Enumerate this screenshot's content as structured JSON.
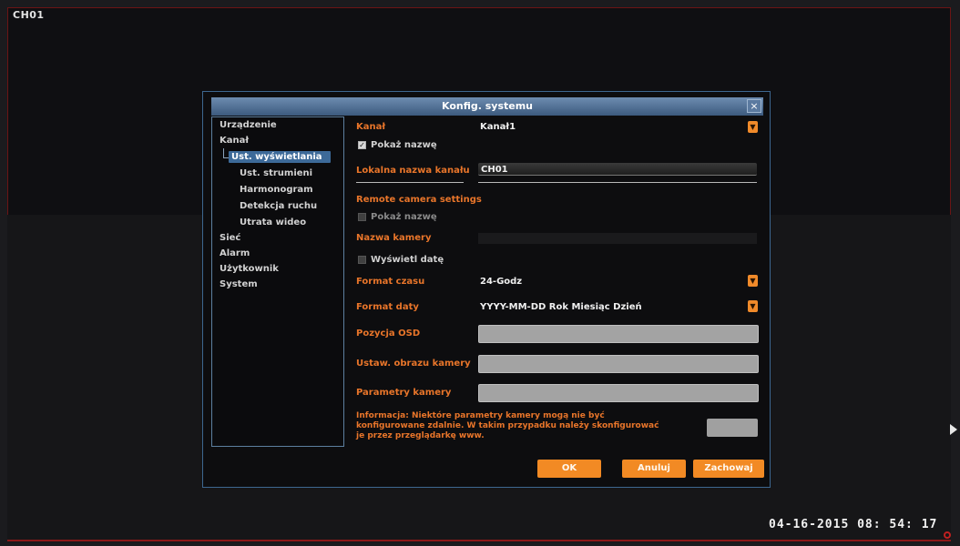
{
  "screen": {
    "channel": "CH01",
    "datetime": "04-16-2015 08: 54: 17"
  },
  "dialog": {
    "title": "Konfig. systemu",
    "close": "×"
  },
  "nav": {
    "items": [
      {
        "label": "Urządzenie"
      },
      {
        "label": "Kanał"
      },
      {
        "label": "Ust. wyświetlania"
      },
      {
        "label": "Ust. strumieni"
      },
      {
        "label": "Harmonogram"
      },
      {
        "label": "Detekcja ruchu"
      },
      {
        "label": "Utrata wideo"
      },
      {
        "label": "Sieć"
      },
      {
        "label": "Alarm"
      },
      {
        "label": "Użytkownik"
      },
      {
        "label": "System"
      }
    ]
  },
  "form": {
    "kanal_label": "Kanał",
    "kanal_value": "Kanał1",
    "show_name_label": "Pokaż nazwę",
    "show_name_checked": true,
    "local_name_label": "Lokalna nazwa kanału",
    "local_name_value": "CH01",
    "remote_heading": "Remote camera settings",
    "remote_show_name_label": "Pokaż nazwę",
    "camera_name_label": "Nazwa kamery",
    "show_date_label": "Wyświetl datę",
    "time_format_label": "Format czasu",
    "time_format_value": "24-Godz",
    "date_format_label": "Format daty",
    "date_format_value": "YYYY-MM-DD Rok Miesiąc Dzień",
    "osd_position_label": "Pozycja OSD",
    "image_settings_label": "Ustaw. obrazu kamery",
    "camera_params_label": "Parametry kamery",
    "info_text_1": "Informacja: Niektóre parametry kamery mogą nie być",
    "info_text_2": "konfigurowane zdalnie. W takim przypadku należy skonfigurować",
    "info_text_3": "je przez przeglądarkę www."
  },
  "buttons": {
    "ok": "OK",
    "cancel": "Anuluj",
    "save": "Zachowaj"
  },
  "icons": {
    "dropdown": "chevron-down-icon",
    "close": "close-icon",
    "check": "✓"
  },
  "colors": {
    "accent": "#f28a24",
    "label": "#e8752a",
    "selection": "#3d6a99",
    "titlebar": "#4f6e93"
  }
}
